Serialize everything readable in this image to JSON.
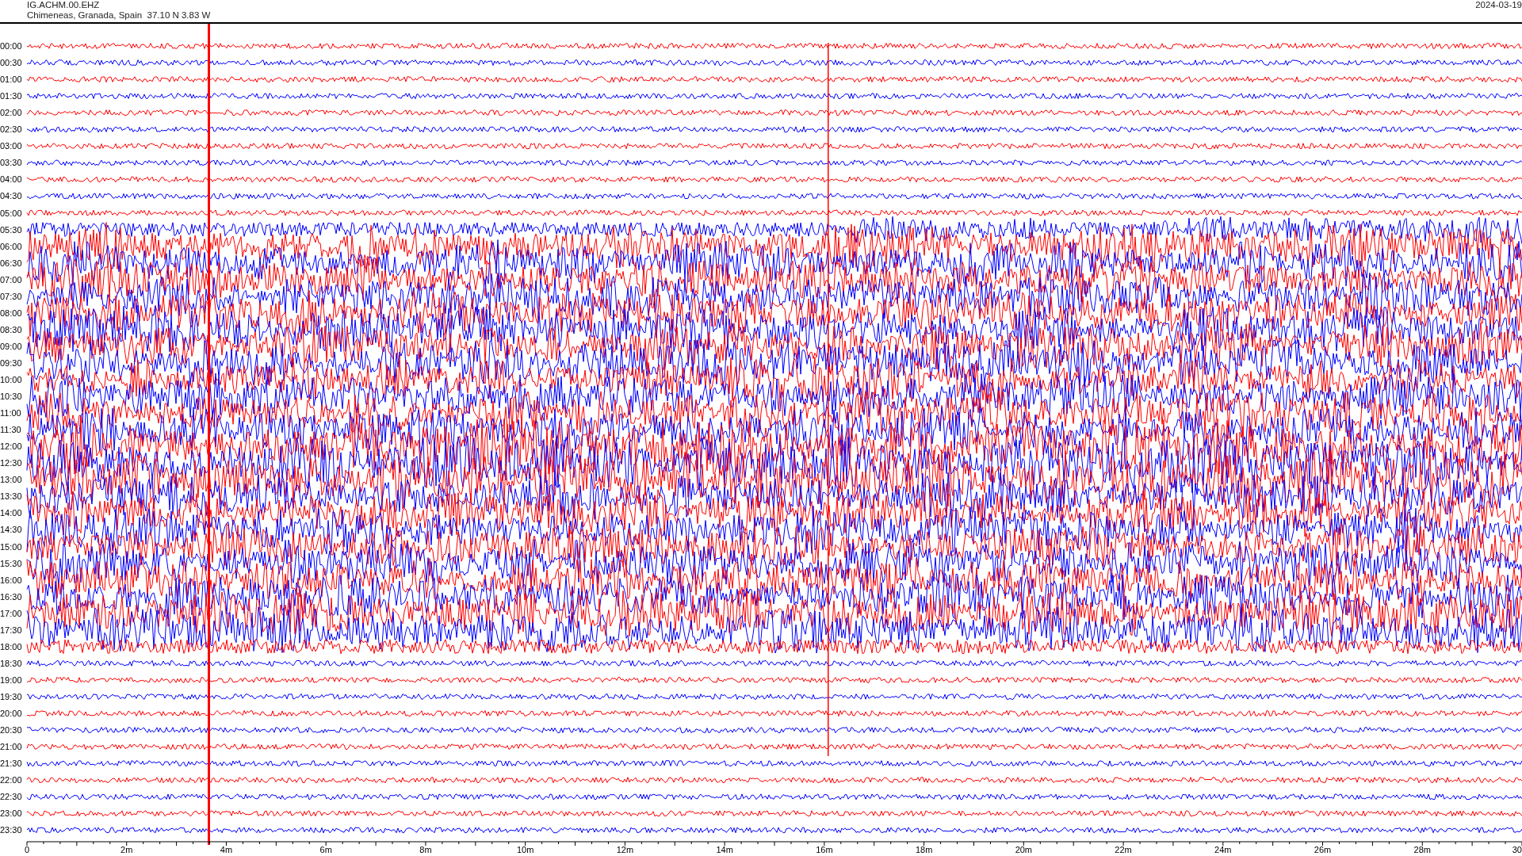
{
  "header": {
    "station": "IG.ACHM.00.EHZ",
    "location": "Chimeneas, Granada, Spain  37.10 N 3.83 W",
    "date": "2024-03-19"
  },
  "traces": [
    {
      "label": "00:00",
      "color": "#ff0000"
    },
    {
      "label": "00:30",
      "color": "#0000ff"
    },
    {
      "label": "01:00",
      "color": "#ff0000"
    },
    {
      "label": "01:30",
      "color": "#0000ff"
    },
    {
      "label": "02:00",
      "color": "#ff0000"
    },
    {
      "label": "02:30",
      "color": "#0000ff"
    },
    {
      "label": "03:00",
      "color": "#ff0000"
    },
    {
      "label": "03:30",
      "color": "#0000ff"
    },
    {
      "label": "04:00",
      "color": "#ff0000"
    },
    {
      "label": "04:30",
      "color": "#0000ff"
    },
    {
      "label": "05:00",
      "color": "#ff0000"
    },
    {
      "label": "05:30",
      "color": "#0000ff"
    },
    {
      "label": "06:00",
      "color": "#ff0000"
    },
    {
      "label": "06:30",
      "color": "#0000ff"
    },
    {
      "label": "07:00",
      "color": "#ff0000"
    },
    {
      "label": "07:30",
      "color": "#0000ff"
    },
    {
      "label": "08:00",
      "color": "#ff0000"
    },
    {
      "label": "08:30",
      "color": "#0000ff"
    },
    {
      "label": "09:00",
      "color": "#ff0000"
    },
    {
      "label": "09:30",
      "color": "#0000ff"
    },
    {
      "label": "10:00",
      "color": "#ff0000"
    },
    {
      "label": "10:30",
      "color": "#0000ff"
    },
    {
      "label": "11:00",
      "color": "#ff0000"
    },
    {
      "label": "11:30",
      "color": "#0000ff"
    },
    {
      "label": "12:00",
      "color": "#ff0000"
    },
    {
      "label": "12:30",
      "color": "#0000ff"
    },
    {
      "label": "13:00",
      "color": "#ff0000"
    },
    {
      "label": "13:30",
      "color": "#0000ff"
    },
    {
      "label": "14:00",
      "color": "#ff0000"
    },
    {
      "label": "14:30",
      "color": "#0000ff"
    },
    {
      "label": "15:00",
      "color": "#ff0000"
    },
    {
      "label": "15:30",
      "color": "#0000ff"
    },
    {
      "label": "16:00",
      "color": "#ff0000"
    },
    {
      "label": "16:30",
      "color": "#0000ff"
    },
    {
      "label": "17:00",
      "color": "#ff0000"
    },
    {
      "label": "17:30",
      "color": "#0000ff"
    },
    {
      "label": "18:00",
      "color": "#ff0000"
    },
    {
      "label": "18:30",
      "color": "#0000ff"
    },
    {
      "label": "19:00",
      "color": "#ff0000"
    },
    {
      "label": "19:30",
      "color": "#0000ff"
    },
    {
      "label": "20:00",
      "color": "#ff0000"
    },
    {
      "label": "20:30",
      "color": "#0000ff"
    },
    {
      "label": "21:00",
      "color": "#ff0000"
    },
    {
      "label": "21:30",
      "color": "#0000ff"
    },
    {
      "label": "22:00",
      "color": "#ff0000"
    },
    {
      "label": "22:30",
      "color": "#0000ff"
    },
    {
      "label": "23:00",
      "color": "#ff0000"
    },
    {
      "label": "23:30",
      "color": "#0000ff"
    }
  ],
  "x_axis": {
    "ticks": [
      "0",
      "2m",
      "4m",
      "6m",
      "8m",
      "10m",
      "12m",
      "14m",
      "16m",
      "18m",
      "20m",
      "22m",
      "24m",
      "26m",
      "28m",
      "30"
    ]
  }
}
